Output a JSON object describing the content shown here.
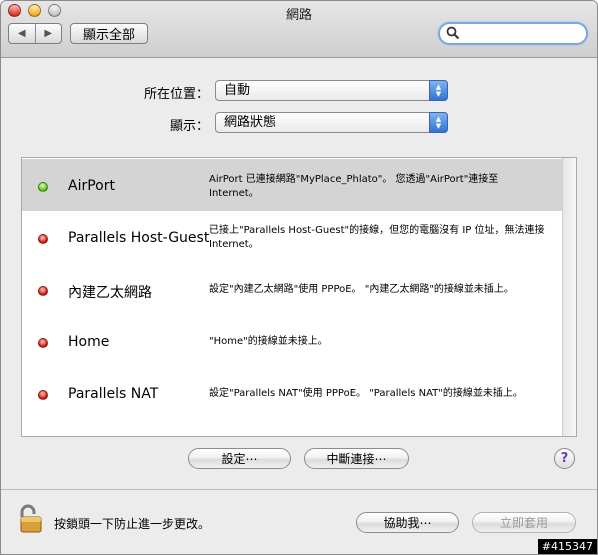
{
  "window": {
    "title": "網路"
  },
  "toolbar": {
    "back_icon": "chevron-left-icon",
    "forward_icon": "chevron-right-icon",
    "show_all_label": "顯示全部",
    "search": {
      "value": "",
      "placeholder": ""
    }
  },
  "location": {
    "label": "所在位置：",
    "value": "自動"
  },
  "show": {
    "label": "顯示：",
    "value": "網路狀態"
  },
  "services": [
    {
      "name": "AirPort",
      "status": "connected",
      "status_color": "#63c61a",
      "description": "AirPort 已連接網路\"MyPlace_Phlato\"。 您透過\"AirPort\"連接至 Internet。",
      "selected": true
    },
    {
      "name": "Parallels Host-Guest",
      "status": "disconnected",
      "status_color": "#e12016",
      "description": "已接上\"Parallels Host-Guest\"的接線，但您的電腦沒有 IP 位址，無法連接 Internet。",
      "selected": false
    },
    {
      "name": "內建乙太網路",
      "status": "disconnected",
      "status_color": "#e12016",
      "description": "設定\"內建乙太網路\"使用 PPPoE。 \"內建乙太網路\"的接線並未插上。",
      "selected": false
    },
    {
      "name": "Home",
      "status": "disconnected",
      "status_color": "#e12016",
      "description": "\"Home\"的接線並未接上。",
      "selected": false
    },
    {
      "name": "Parallels NAT",
      "status": "disconnected",
      "status_color": "#e12016",
      "description": "設定\"Parallels NAT\"使用 PPPoE。 \"Parallels NAT\"的接線並未插上。",
      "selected": false
    }
  ],
  "actions": {
    "configure_label": "設定⋯",
    "disconnect_label": "中斷連接⋯",
    "help_glyph": "?"
  },
  "footer": {
    "lock_text": "按鎖頭一下防止進一步更改。",
    "assist_label": "協助我⋯",
    "apply_label": "立即套用",
    "watermark": "#415347"
  },
  "colors": {
    "accent": "#2f73d6",
    "selected_row": "#d4d4d4",
    "help_icon": "#6a3db0"
  }
}
